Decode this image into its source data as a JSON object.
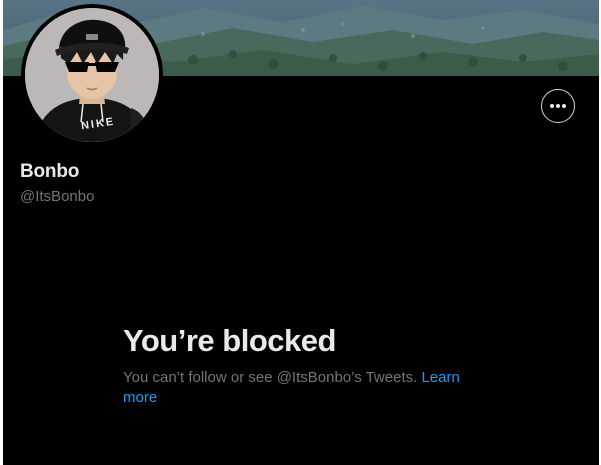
{
  "profile": {
    "display_name": "Bonbo",
    "handle": "@ItsBonbo",
    "avatar_text": "NIKE"
  },
  "actions": {
    "more_icon": "more-horizontal-icon"
  },
  "blocked": {
    "title": "You’re blocked",
    "message": "You can’t follow or see @ItsBonbo’s Tweets. ",
    "learn_more": "Learn more"
  },
  "colors": {
    "background": "#000000",
    "primary_text": "#e7e9ea",
    "secondary_text": "#71767b",
    "link": "#1d9bf0"
  }
}
